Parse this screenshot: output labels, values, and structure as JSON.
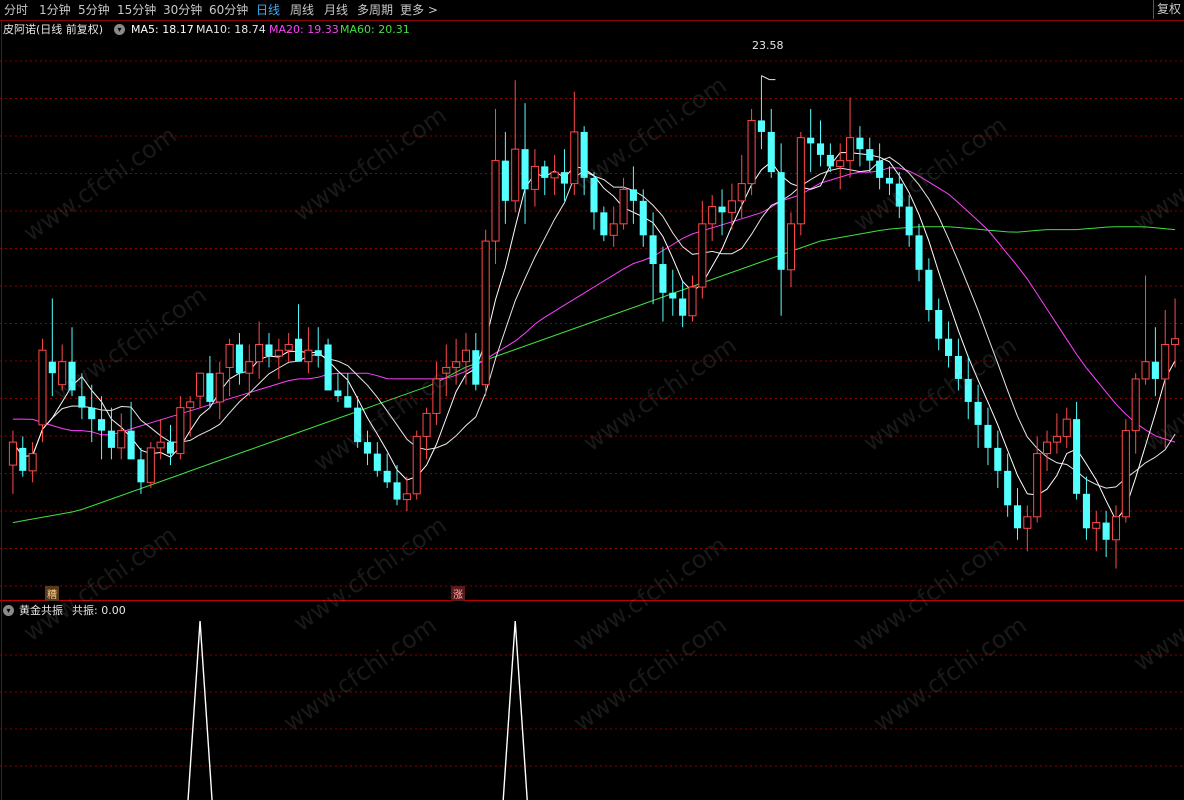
{
  "toolbar": {
    "tabs": [
      "分时",
      "1分钟",
      "5分钟",
      "15分钟",
      "30分钟",
      "60分钟",
      "日线",
      "周线",
      "月线",
      "多周期",
      "更多 >"
    ],
    "active_index": 6,
    "right_label": "复权"
  },
  "main_legend": {
    "title": "皮阿诺(日线 前复权)",
    "ma5": "MA5: 18.17",
    "ma10": "MA10: 18.74",
    "ma20": "MA20: 19.33",
    "ma60": "MA60: 20.31"
  },
  "high_marker": "23.58",
  "badges": {
    "left": "糟",
    "right": "涨"
  },
  "indicator_legend": {
    "title": "黄金共振",
    "value": "共振: 0.00"
  },
  "watermark": "www.cfchi.com",
  "colors": {
    "up": "#ff4a4a",
    "down": "#54ffff",
    "ma5": "#ffffff",
    "ma10": "#e6e6e6",
    "ma20": "#ff40ff",
    "ma60": "#40e040",
    "grid": "#8b0000",
    "active_tab": "#3fa9f5"
  },
  "chart_data": {
    "type": "candlestick",
    "price_unit": "yuan",
    "candles": [
      [
        16.8,
        17.4,
        16.3,
        17.2
      ],
      [
        17.1,
        17.3,
        16.6,
        16.7
      ],
      [
        16.7,
        17.2,
        16.5,
        17.0
      ],
      [
        17.5,
        19.0,
        17.2,
        18.8
      ],
      [
        18.6,
        19.7,
        18.0,
        18.4
      ],
      [
        18.2,
        18.9,
        18.1,
        18.6
      ],
      [
        18.6,
        19.2,
        18.0,
        18.1
      ],
      [
        18.0,
        18.4,
        17.6,
        17.8
      ],
      [
        17.8,
        18.2,
        17.2,
        17.6
      ],
      [
        17.6,
        18.0,
        16.9,
        17.4
      ],
      [
        17.4,
        17.8,
        16.9,
        17.1
      ],
      [
        17.1,
        17.7,
        16.9,
        17.4
      ],
      [
        17.4,
        17.9,
        16.9,
        16.9
      ],
      [
        16.9,
        17.1,
        16.3,
        16.5
      ],
      [
        16.5,
        17.2,
        16.4,
        17.1
      ],
      [
        17.1,
        17.6,
        16.9,
        17.2
      ],
      [
        17.2,
        17.5,
        16.8,
        17.0
      ],
      [
        17.0,
        18.0,
        16.9,
        17.8
      ],
      [
        17.8,
        18.0,
        17.3,
        17.9
      ],
      [
        18.0,
        18.4,
        17.8,
        18.4
      ],
      [
        18.4,
        18.7,
        17.8,
        17.9
      ],
      [
        17.9,
        18.6,
        17.6,
        18.4
      ],
      [
        18.5,
        19.0,
        18.0,
        18.9
      ],
      [
        18.9,
        19.1,
        18.2,
        18.4
      ],
      [
        18.4,
        18.9,
        18.0,
        18.6
      ],
      [
        18.6,
        19.3,
        18.3,
        18.9
      ],
      [
        18.9,
        19.1,
        18.5,
        18.7
      ],
      [
        18.7,
        19.0,
        18.3,
        18.8
      ],
      [
        18.8,
        19.1,
        18.6,
        18.9
      ],
      [
        19.0,
        19.6,
        18.8,
        18.6
      ],
      [
        18.6,
        19.2,
        18.4,
        18.8
      ],
      [
        18.8,
        19.2,
        18.5,
        18.7
      ],
      [
        18.9,
        19.0,
        18.3,
        18.1
      ],
      [
        18.1,
        18.4,
        17.9,
        18.0
      ],
      [
        18.0,
        18.4,
        17.8,
        17.8
      ],
      [
        17.8,
        18.0,
        17.1,
        17.2
      ],
      [
        17.2,
        17.4,
        16.8,
        17.0
      ],
      [
        17.0,
        17.2,
        16.6,
        16.7
      ],
      [
        16.7,
        17.0,
        16.4,
        16.5
      ],
      [
        16.5,
        16.8,
        16.1,
        16.2
      ],
      [
        16.2,
        16.6,
        16.0,
        16.3
      ],
      [
        16.3,
        17.4,
        16.2,
        17.3
      ],
      [
        17.3,
        17.8,
        16.9,
        17.7
      ],
      [
        17.7,
        18.6,
        17.5,
        18.3
      ],
      [
        18.4,
        18.9,
        18.0,
        18.5
      ],
      [
        18.5,
        19.0,
        18.2,
        18.6
      ],
      [
        18.6,
        19.1,
        18.2,
        18.8
      ],
      [
        18.8,
        19.1,
        18.1,
        18.2
      ],
      [
        18.2,
        20.9,
        18.0,
        20.7
      ],
      [
        20.7,
        23.0,
        20.3,
        22.1
      ],
      [
        22.1,
        22.6,
        21.0,
        21.4
      ],
      [
        21.4,
        23.5,
        21.2,
        22.3
      ],
      [
        22.3,
        23.1,
        21.0,
        21.6
      ],
      [
        21.6,
        22.3,
        21.3,
        22.0
      ],
      [
        22.0,
        22.1,
        21.5,
        21.8
      ],
      [
        21.8,
        22.2,
        21.5,
        21.9
      ],
      [
        21.9,
        22.3,
        21.4,
        21.7
      ],
      [
        21.7,
        23.3,
        21.5,
        22.6
      ],
      [
        22.6,
        22.7,
        21.5,
        21.8
      ],
      [
        21.8,
        21.9,
        20.9,
        21.2
      ],
      [
        21.2,
        21.3,
        20.7,
        20.8
      ],
      [
        20.8,
        21.3,
        20.6,
        21.0
      ],
      [
        21.0,
        21.8,
        20.9,
        21.6
      ],
      [
        21.6,
        22.0,
        21.0,
        21.4
      ],
      [
        21.4,
        21.6,
        20.6,
        20.8
      ],
      [
        20.8,
        21.2,
        19.6,
        20.3
      ],
      [
        20.3,
        20.6,
        19.3,
        19.8
      ],
      [
        19.8,
        20.2,
        19.4,
        19.7
      ],
      [
        19.7,
        20.0,
        19.2,
        19.4
      ],
      [
        19.4,
        20.1,
        19.3,
        19.9
      ],
      [
        19.9,
        21.4,
        19.7,
        21.0
      ],
      [
        21.0,
        21.5,
        20.7,
        21.3
      ],
      [
        21.3,
        21.6,
        20.8,
        21.2
      ],
      [
        21.2,
        21.7,
        20.9,
        21.4
      ],
      [
        21.4,
        22.2,
        21.1,
        21.7
      ],
      [
        21.7,
        23.0,
        21.5,
        22.8
      ],
      [
        22.8,
        23.58,
        22.3,
        22.6
      ],
      [
        22.6,
        23.0,
        21.8,
        21.9
      ],
      [
        21.9,
        22.4,
        19.4,
        20.2
      ],
      [
        20.2,
        21.2,
        19.9,
        21.0
      ],
      [
        21.0,
        22.6,
        20.8,
        22.5
      ],
      [
        22.5,
        23.0,
        21.9,
        22.4
      ],
      [
        22.4,
        22.8,
        22.0,
        22.2
      ],
      [
        22.2,
        22.4,
        21.9,
        22.0
      ],
      [
        22.0,
        22.4,
        21.6,
        22.1
      ],
      [
        22.1,
        23.2,
        21.8,
        22.5
      ],
      [
        22.5,
        22.7,
        22.0,
        22.3
      ],
      [
        22.3,
        22.5,
        21.9,
        22.1
      ],
      [
        22.1,
        22.4,
        21.6,
        21.8
      ],
      [
        21.8,
        22.0,
        21.5,
        21.7
      ],
      [
        21.7,
        21.9,
        21.1,
        21.3
      ],
      [
        21.3,
        21.5,
        20.6,
        20.8
      ],
      [
        20.8,
        21.0,
        20.0,
        20.2
      ],
      [
        20.2,
        20.4,
        19.3,
        19.5
      ],
      [
        19.5,
        19.7,
        18.8,
        19.0
      ],
      [
        19.0,
        19.3,
        18.5,
        18.7
      ],
      [
        18.7,
        19.0,
        18.1,
        18.3
      ],
      [
        18.3,
        18.7,
        17.6,
        17.9
      ],
      [
        17.9,
        18.2,
        17.1,
        17.5
      ],
      [
        17.5,
        17.8,
        16.8,
        17.1
      ],
      [
        17.1,
        17.4,
        16.4,
        16.7
      ],
      [
        16.7,
        17.0,
        15.9,
        16.1
      ],
      [
        16.1,
        16.4,
        15.5,
        15.7
      ],
      [
        15.7,
        16.1,
        15.3,
        15.9
      ],
      [
        15.9,
        17.3,
        15.8,
        17.0
      ],
      [
        17.0,
        17.4,
        16.7,
        17.2
      ],
      [
        17.2,
        17.7,
        17.0,
        17.3
      ],
      [
        17.3,
        17.8,
        17.1,
        17.6
      ],
      [
        17.6,
        17.9,
        16.2,
        16.3
      ],
      [
        16.3,
        16.6,
        15.5,
        15.7
      ],
      [
        15.7,
        16.0,
        15.3,
        15.8
      ],
      [
        15.8,
        16.0,
        15.2,
        15.5
      ],
      [
        15.5,
        16.1,
        15.0,
        15.9
      ],
      [
        15.9,
        17.6,
        15.8,
        17.4
      ],
      [
        17.4,
        18.4,
        17.0,
        18.3
      ],
      [
        18.3,
        20.1,
        18.2,
        18.6
      ],
      [
        18.6,
        19.2,
        18.0,
        18.3
      ],
      [
        18.3,
        19.5,
        17.1,
        18.9
      ],
      [
        18.9,
        19.7,
        18.5,
        19.0
      ]
    ],
    "ma20": [
      17.6,
      17.6,
      17.5,
      17.4,
      17.4,
      17.3,
      17.4,
      17.5,
      17.6,
      17.7,
      17.8,
      17.9,
      18.0,
      18.1,
      18.2,
      18.3,
      18.3,
      18.4,
      18.4,
      18.4,
      18.3,
      18.3,
      18.3,
      18.3,
      18.4,
      18.6,
      18.8,
      19.0,
      19.3,
      19.5,
      19.7,
      19.9,
      20.1,
      20.3,
      20.4,
      20.6,
      20.8,
      20.9,
      21.0,
      21.1,
      21.2,
      21.4,
      21.5,
      21.7,
      21.8,
      21.9,
      21.9,
      22.0,
      21.9,
      21.7,
      21.5,
      21.2,
      20.9,
      20.5,
      20.1,
      19.6,
      19.1,
      18.6,
      18.2,
      17.8,
      17.5,
      17.3,
      17.2
    ],
    "ma60": [
      15.8,
      15.9,
      16.0,
      16.2,
      16.4,
      16.6,
      16.8,
      17.0,
      17.2,
      17.4,
      17.6,
      17.8,
      18.0,
      18.2,
      18.5,
      18.7,
      18.9,
      19.1,
      19.3,
      19.5,
      19.7,
      19.9,
      20.1,
      20.3,
      20.5,
      20.7,
      20.8,
      20.9,
      20.95,
      20.95,
      20.9,
      20.85,
      20.9,
      20.9,
      20.95,
      20.95,
      20.9
    ],
    "indicator": {
      "name": "共振",
      "signals_at_candle": [
        19,
        51
      ]
    },
    "high_label": "23.58",
    "ylim": [
      14.8,
      24.2
    ]
  }
}
